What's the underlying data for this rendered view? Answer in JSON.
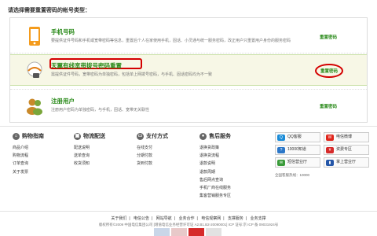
{
  "prompt": "请选择需要重置密码的帐号类型：",
  "options": [
    {
      "title": "手机号码",
      "desc": "要提供证件号码和手机或宽带密码等信息，重置后个人在家使用手机，固话、小灵通与统一服务密码，改正用户只重置用户身份的服务密码",
      "reset": "重置密码"
    },
    {
      "title": "天翼有线宽带拨号密码重置",
      "desc": "需提供证件号码，宽带密码为单独密码，包括单上网拨号密码，与手机、固话密码均为不一致",
      "reset": "重置密码"
    },
    {
      "title": "注册用户",
      "desc": "注册用户密码为单独密码，与手机，固话、宽带无关联性",
      "reset": "重置密码"
    }
  ],
  "footer": {
    "cols": [
      {
        "title": "购物指南",
        "icon": "cart-icon",
        "items": [
          "商品介绍",
          "购物流程",
          "订单查询",
          "关于发票"
        ]
      },
      {
        "title": "物流配送",
        "icon": "truck-icon",
        "items": [
          "配送说明",
          "送单查询",
          "收货须知"
        ]
      },
      {
        "title": "支付方式",
        "icon": "card-icon",
        "items": [
          "在线支付",
          "分期付款",
          "货到付款"
        ]
      },
      {
        "title": "售后服务",
        "icon": "location-icon",
        "items": [
          "退换货政策",
          "退换货流程",
          "退款说明",
          "退款周期",
          "售后网点查询",
          "手机厂商在线服务",
          "集客营销服务专区"
        ]
      }
    ],
    "contacts": [
      "QQ客服",
      "电信微博",
      "10000知道",
      "资费专区",
      "短信营业厅",
      "掌上营业厅"
    ],
    "contact_hint": "全国客服热线：10000"
  },
  "links": [
    "关于我们",
    "电信公告",
    "网站导航",
    "业务合作",
    "电信观察网",
    "支撑服务",
    "业务支撑"
  ],
  "copyright": "版权所有©2009 中国电信集团公司 [增值电信业务经营许可证 A2.B1.B2-20090001] ICP 证号:京 ICP 备 09031924号",
  "colors": {
    "accent": "#2a8a1a",
    "highlight": "#d40000"
  }
}
